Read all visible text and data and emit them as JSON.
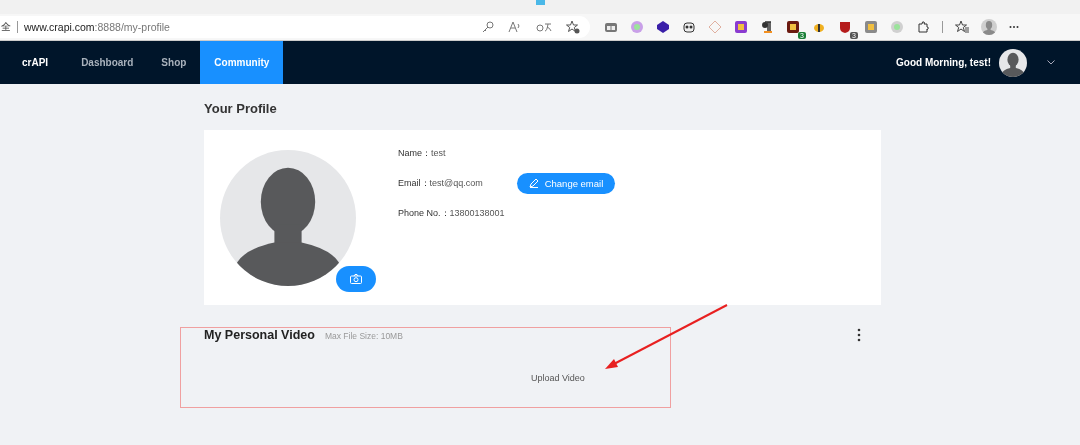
{
  "browser": {
    "address_prefix": "全",
    "url": "**www.crapi.com**:8888/my-profile",
    "extensions": [
      {
        "kind": "tabs"
      },
      {
        "kind": "dot",
        "color": "#c9a0e8"
      },
      {
        "kind": "cube",
        "color": "#3a1fa8"
      },
      {
        "kind": "panda"
      },
      {
        "kind": "diamond"
      },
      {
        "kind": "square",
        "color": "#8a3bd0"
      },
      {
        "kind": "pilcrow"
      },
      {
        "kind": "square",
        "color": "#6b1a10",
        "badge": "3"
      },
      {
        "kind": "bee"
      },
      {
        "kind": "shield",
        "color": "#b51c1c",
        "badge": "3"
      },
      {
        "kind": "square",
        "color": "#8a8a8a"
      },
      {
        "kind": "dot",
        "color": "#d0d0d0"
      },
      {
        "kind": "puzzle"
      }
    ]
  },
  "nav": {
    "brand": "crAPI",
    "items": [
      {
        "label": "Dashboard",
        "selected": false
      },
      {
        "label": "Shop",
        "selected": false
      },
      {
        "label": "Community",
        "selected": true
      }
    ],
    "greeting": "Good Morning, test!"
  },
  "profile": {
    "title": "Your Profile",
    "fields": [
      {
        "label": "Name：",
        "value": "test"
      },
      {
        "label": "Email：",
        "value": "test@qq.com",
        "action": "Change email"
      },
      {
        "label": "Phone No.：",
        "value": "13800138001"
      }
    ]
  },
  "video": {
    "title": "My Personal Video",
    "hint": "Max File Size: 10MB",
    "upload": "Upload Video"
  }
}
